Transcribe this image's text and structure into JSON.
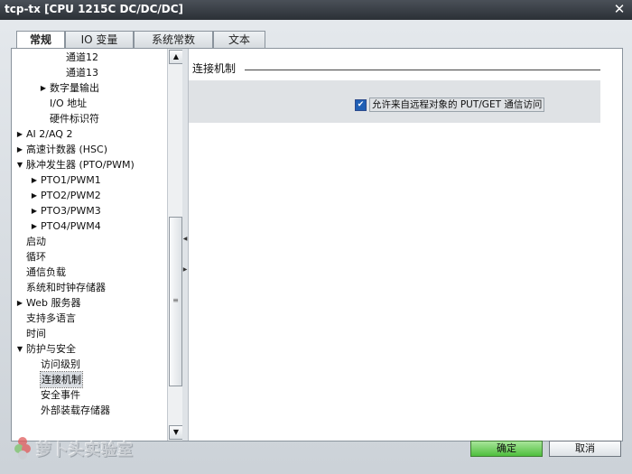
{
  "window": {
    "title": "tcp-tx [CPU 1215C DC/DC/DC]",
    "close_glyph": "✕"
  },
  "tabs": [
    {
      "label": "常规",
      "active": true
    },
    {
      "label": "IO 变量",
      "active": false
    },
    {
      "label": "系统常数",
      "active": false
    },
    {
      "label": "文本",
      "active": false
    }
  ],
  "tree": {
    "items": [
      {
        "label": "通道12",
        "level": 3,
        "expander": "",
        "selected": false
      },
      {
        "label": "通道13",
        "level": 3,
        "expander": "",
        "selected": false
      },
      {
        "label": "数字量输出",
        "level": 2,
        "expander": "collapsed",
        "selected": false
      },
      {
        "label": "I/O 地址",
        "level": 2,
        "expander": "",
        "selected": false
      },
      {
        "label": "硬件标识符",
        "level": 2,
        "expander": "",
        "selected": false
      },
      {
        "label": "AI 2/AQ 2",
        "level": 0,
        "expander": "collapsed",
        "selected": false
      },
      {
        "label": "高速计数器 (HSC)",
        "level": 0,
        "expander": "collapsed",
        "selected": false
      },
      {
        "label": "脉冲发生器 (PTO/PWM)",
        "level": 0,
        "expander": "expanded",
        "selected": false
      },
      {
        "label": "PTO1/PWM1",
        "level": 1,
        "expander": "collapsed",
        "selected": false
      },
      {
        "label": "PTO2/PWM2",
        "level": 1,
        "expander": "collapsed",
        "selected": false
      },
      {
        "label": "PTO3/PWM3",
        "level": 1,
        "expander": "collapsed",
        "selected": false
      },
      {
        "label": "PTO4/PWM4",
        "level": 1,
        "expander": "collapsed",
        "selected": false
      },
      {
        "label": "启动",
        "level": 0,
        "expander": "",
        "selected": false
      },
      {
        "label": "循环",
        "level": 0,
        "expander": "",
        "selected": false
      },
      {
        "label": "通信负载",
        "level": 0,
        "expander": "",
        "selected": false
      },
      {
        "label": "系统和时钟存储器",
        "level": 0,
        "expander": "",
        "selected": false
      },
      {
        "label": "Web 服务器",
        "level": 0,
        "expander": "collapsed",
        "selected": false
      },
      {
        "label": "支持多语言",
        "level": 0,
        "expander": "",
        "selected": false
      },
      {
        "label": "时间",
        "level": 0,
        "expander": "",
        "selected": false
      },
      {
        "label": "防护与安全",
        "level": 0,
        "expander": "expanded",
        "selected": false
      },
      {
        "label": "访问级别",
        "level": 1,
        "expander": "",
        "selected": false
      },
      {
        "label": "连接机制",
        "level": 1,
        "expander": "",
        "selected": true
      },
      {
        "label": "安全事件",
        "level": 1,
        "expander": "",
        "selected": false
      },
      {
        "label": "外部装载存储器",
        "level": 1,
        "expander": "",
        "selected": false
      }
    ],
    "scroll_up_glyph": "▲",
    "scroll_down_glyph": "▼",
    "thumb_grip_glyph": "≡",
    "splitter_left_glyph": "◀",
    "splitter_right_glyph": "▶"
  },
  "content": {
    "section_title": "连接机制",
    "checkbox": {
      "label": "允许来自远程对象的 PUT/GET 通信访问",
      "checked": true,
      "check_glyph": "✔"
    }
  },
  "footer": {
    "watermark_text": "萝卜头实验室",
    "ok_label": "确定",
    "cancel_label": "取消"
  },
  "colors": {
    "ok_button": "#4fbf3d",
    "checkbox": "#1f5fb5",
    "titlebar": "#2b3036"
  }
}
